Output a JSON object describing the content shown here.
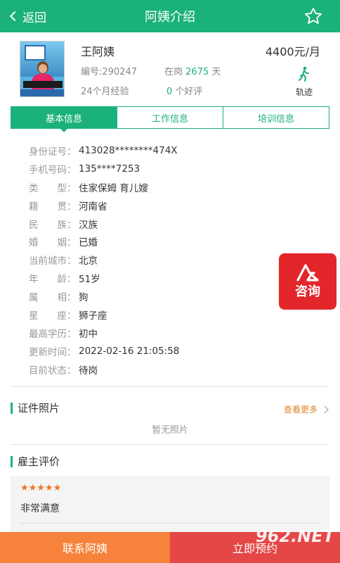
{
  "header": {
    "back_label": "返回",
    "title": "阿姨介绍"
  },
  "profile": {
    "name": "王阿姨",
    "salary": "4400元/月",
    "id_label": "编号:",
    "id_value": "290247",
    "onjob_label": "在岗",
    "onjob_days": "2675",
    "onjob_unit": "天",
    "experience": "24个月经验",
    "good_reviews_count": "0",
    "good_reviews_label": "个好评",
    "track_label": "轨迹"
  },
  "tabs": [
    {
      "label": "基本信息",
      "active": true
    },
    {
      "label": "工作信息",
      "active": false
    },
    {
      "label": "培训信息",
      "active": false
    }
  ],
  "basic_info": [
    {
      "key": "身份证号：",
      "value": "413028********474X"
    },
    {
      "key": "手机号码：",
      "value": "135****7253"
    },
    {
      "key": "类　　型：",
      "value": "住家保姆 育儿嫂"
    },
    {
      "key": "籍　　贯：",
      "value": "河南省"
    },
    {
      "key": "民　　族：",
      "value": "汉族"
    },
    {
      "key": "婚　　姻：",
      "value": "已婚"
    },
    {
      "key": "当前城市：",
      "value": "北京"
    },
    {
      "key": "年　　龄：",
      "value": "51岁"
    },
    {
      "key": "属　　相：",
      "value": "狗"
    },
    {
      "key": "星　　座：",
      "value": "狮子座"
    },
    {
      "key": "最高学历：",
      "value": "初中"
    },
    {
      "key": "更新时间：",
      "value": "2022-02-16 21:05:58"
    },
    {
      "key": "目前状态：",
      "value": "待岗"
    }
  ],
  "consult": {
    "label": "咨询"
  },
  "certificates": {
    "title": "证件照片",
    "more_label": "查看更多",
    "empty_text": "暂无照片"
  },
  "reviews": {
    "title": "雇主评价",
    "stars": "★★★★★",
    "rating": 5,
    "text": "非常满意"
  },
  "bottom": {
    "contact_label": "联系阿姨",
    "book_label": "立即预约"
  },
  "watermark": "962.NET",
  "colors": {
    "primary": "#1bb17a",
    "consult": "#e3262a",
    "contact": "#f6823b",
    "book": "#e54646",
    "star": "#f0731f"
  }
}
